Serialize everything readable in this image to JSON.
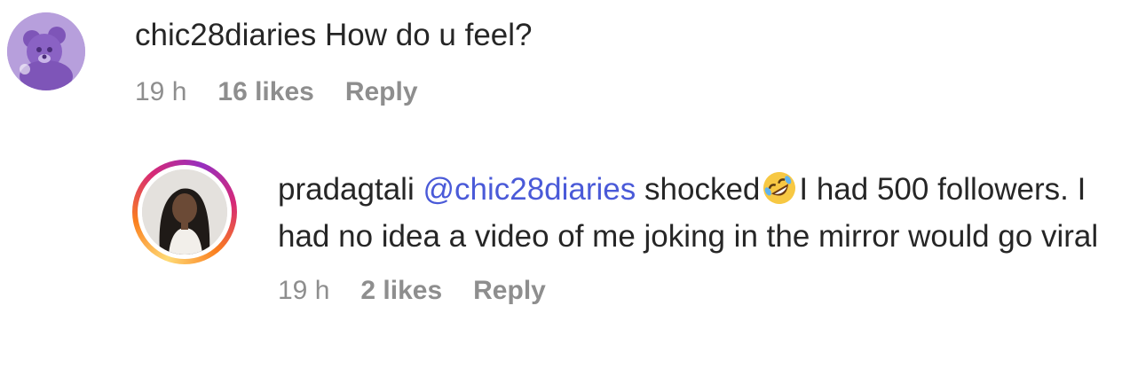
{
  "comments": [
    {
      "username": "chic28diaries",
      "mention": "",
      "text_before_emoji": "How do u feel?",
      "emoji": "",
      "text_after_emoji": "",
      "time": "19 h",
      "likes": "16 likes",
      "reply_label": "Reply",
      "avatar": "purple-teddy-bear-avatar",
      "avatar_color": "#b79fdc"
    },
    {
      "username": "pradagtali",
      "mention": "@chic28diaries",
      "text_before_emoji": "shocked",
      "emoji": "rolling-on-floor-laughing-emoji",
      "text_after_emoji": "I had 500 followers. I had no idea a video of me joking in the mirror would go viral",
      "time": "19 h",
      "likes": "2 likes",
      "reply_label": "Reply",
      "avatar": "profile-photo-with-story-ring",
      "mention_color": "#4a5ad8"
    }
  ]
}
